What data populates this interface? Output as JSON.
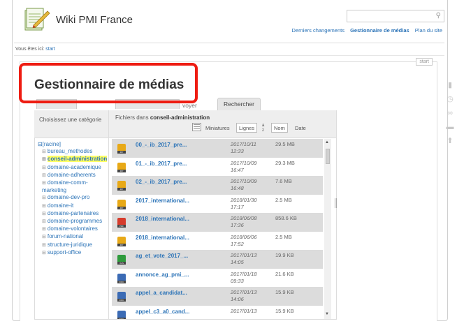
{
  "site": {
    "title": "Wiki PMI France"
  },
  "search": {
    "placeholder": ""
  },
  "toplinks": {
    "recent": "Derniers changements",
    "media": "Gestionnaire de médias",
    "sitemap": "Plan du site"
  },
  "breadcrumb": {
    "prefix": "Vous êtes ici:",
    "current": "start"
  },
  "page": {
    "tag": "start",
    "title": "Gestionnaire de médias"
  },
  "tabs": {
    "envoyer": "voyer",
    "rechercher": "Rechercher"
  },
  "left": {
    "heading": "Choisissez une catégorie"
  },
  "right": {
    "files_in_prefix": "Fichiers dans",
    "files_in_ns": "conseil-administration",
    "view": {
      "thumbs": "Miniatures",
      "rows": "Lignes",
      "sort_icon": "az",
      "name": "Nom",
      "date": "Date"
    }
  },
  "tree": [
    {
      "label": "[racine]",
      "pm": "⊟",
      "level": 0
    },
    {
      "label": "bureau_methodes",
      "pm": "⊞",
      "level": 1
    },
    {
      "label": "conseil-administration",
      "pm": "⊞",
      "level": 1,
      "current": true
    },
    {
      "label": "domaine-academique",
      "pm": "⊞",
      "level": 1
    },
    {
      "label": "domaine-adherents",
      "pm": "⊞",
      "level": 1
    },
    {
      "label": "domaine-comm-marketing",
      "pm": "⊞",
      "level": 1
    },
    {
      "label": "domaine-dev-pro",
      "pm": "⊞",
      "level": 1
    },
    {
      "label": "domaine-it",
      "pm": "⊞",
      "level": 1
    },
    {
      "label": "domaine-partenaires",
      "pm": "⊞",
      "level": 1
    },
    {
      "label": "domaine-programmes",
      "pm": "⊞",
      "level": 1
    },
    {
      "label": "domaine-volontaires",
      "pm": "⊞",
      "level": 1
    },
    {
      "label": "forum-national",
      "pm": "⊞",
      "level": 1
    },
    {
      "label": "structure-juridique",
      "pm": "⊞",
      "level": 1
    },
    {
      "label": "support-office",
      "pm": "⊞",
      "level": 1
    }
  ],
  "files": [
    {
      "name": "00_-_ib_2017_pre...",
      "date": "2017/10/11",
      "time": "12:33",
      "size": "29.5 MB",
      "icon": "zip-icon",
      "color": "#e8a917",
      "lbl": "ZIP"
    },
    {
      "name": "01_-_ib_2017_pre...",
      "date": "2017/10/09",
      "time": "16:47",
      "size": "29.3 MB",
      "icon": "zip-icon",
      "color": "#e8a917",
      "lbl": "ZIP"
    },
    {
      "name": "02_-_ib_2017_pre...",
      "date": "2017/10/09",
      "time": "16:48",
      "size": "7.6 MB",
      "icon": "zip-icon",
      "color": "#e8a917",
      "lbl": "ZIP"
    },
    {
      "name": "2017_international...",
      "date": "2018/01/30",
      "time": "17:17",
      "size": "2.5 MB",
      "icon": "zip-icon",
      "color": "#e8a917",
      "lbl": "ZIP"
    },
    {
      "name": "2018_international...",
      "date": "2018/06/08",
      "time": "17:36",
      "size": "858.6 KB",
      "icon": "pdf-icon",
      "color": "#d63c2c",
      "lbl": "PDF"
    },
    {
      "name": "2018_international...",
      "date": "2018/06/06",
      "time": "17:52",
      "size": "2.5 MB",
      "icon": "zip-icon",
      "color": "#e8a917",
      "lbl": "ZIP"
    },
    {
      "name": "ag_et_vote_2017_...",
      "date": "2017/01/13",
      "time": "14:05",
      "size": "19.9 KB",
      "icon": "xls-icon",
      "color": "#2e9b3c",
      "lbl": "XLS"
    },
    {
      "name": "annonce_ag_pmi_...",
      "date": "2017/01/18",
      "time": "09:33",
      "size": "21.6 KB",
      "icon": "doc-icon",
      "color": "#3b6bb5",
      "lbl": "DOC"
    },
    {
      "name": "appel_a_candidat...",
      "date": "2017/01/13",
      "time": "14:06",
      "size": "15.9 KB",
      "icon": "doc-icon",
      "color": "#3b6bb5",
      "lbl": "DOC"
    },
    {
      "name": "appel_c3_a0_cand...",
      "date": "2017/01/13",
      "time": "",
      "size": "15.9 KB",
      "icon": "doc-icon",
      "color": "#3b6bb5",
      "lbl": "DOC"
    }
  ],
  "colors": {
    "highlight": "#ee1c12",
    "link": "#2b73b7",
    "current_bg": "#ffff66"
  }
}
